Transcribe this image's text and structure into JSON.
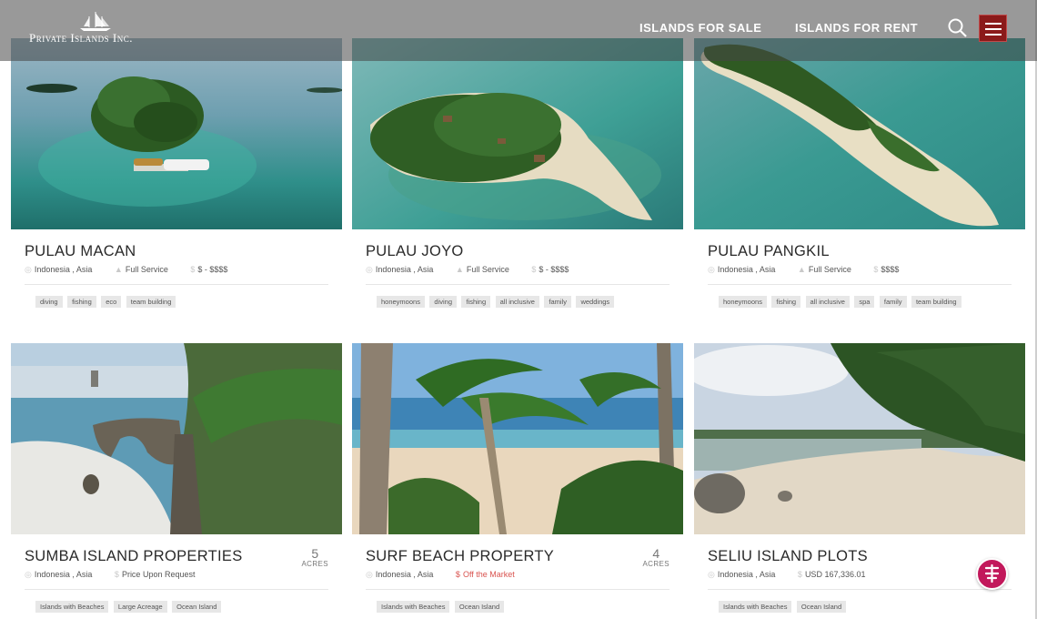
{
  "header": {
    "logo_text": "Private Islands Inc.",
    "nav": {
      "sale": "ISLANDS FOR SALE",
      "rent": "ISLANDS FOR RENT"
    },
    "menu_color": "#8b1a1a"
  },
  "listings": [
    {
      "title": "PULAU MACAN",
      "location": "Indonesia , Asia",
      "service": "Full Service",
      "price": "$ - $$$$",
      "tags": [
        "diving",
        "fishing",
        "eco",
        "team building"
      ]
    },
    {
      "title": "PULAU JOYO",
      "location": "Indonesia , Asia",
      "service": "Full Service",
      "price": "$ - $$$$",
      "tags": [
        "honeymoons",
        "diving",
        "fishing",
        "all inclusive",
        "family",
        "weddings"
      ]
    },
    {
      "title": "PULAU PANGKIL",
      "location": "Indonesia , Asia",
      "service": "Full Service",
      "price": "$$$$",
      "tags": [
        "honeymoons",
        "fishing",
        "all inclusive",
        "spa",
        "family",
        "team building"
      ]
    },
    {
      "title": "SUMBA ISLAND PROPERTIES",
      "location": "Indonesia , Asia",
      "price": "Price Upon Request",
      "acres_value": "5",
      "acres_unit": "ACRES",
      "tags": [
        "Islands with Beaches",
        "Large Acreage",
        "Ocean Island"
      ]
    },
    {
      "title": "SURF BEACH PROPERTY",
      "location": "Indonesia , Asia",
      "price": "Off the Market",
      "acres_value": "4",
      "acres_unit": "ACRES",
      "tags": [
        "Islands with Beaches",
        "Ocean Island"
      ]
    },
    {
      "title": "SELIU ISLAND PLOTS",
      "location": "Indonesia , Asia",
      "price": "USD 167,336.01",
      "tags": [
        "Islands with Beaches",
        "Ocean Island"
      ]
    }
  ],
  "icons": {
    "location": "map-pin-icon",
    "service": "person-icon",
    "price": "dollar-icon",
    "search": "search-icon",
    "menu": "hamburger-icon",
    "chat": "chat-icon"
  },
  "colors": {
    "off_market": "#d9534f",
    "chat": "#c2185b"
  }
}
